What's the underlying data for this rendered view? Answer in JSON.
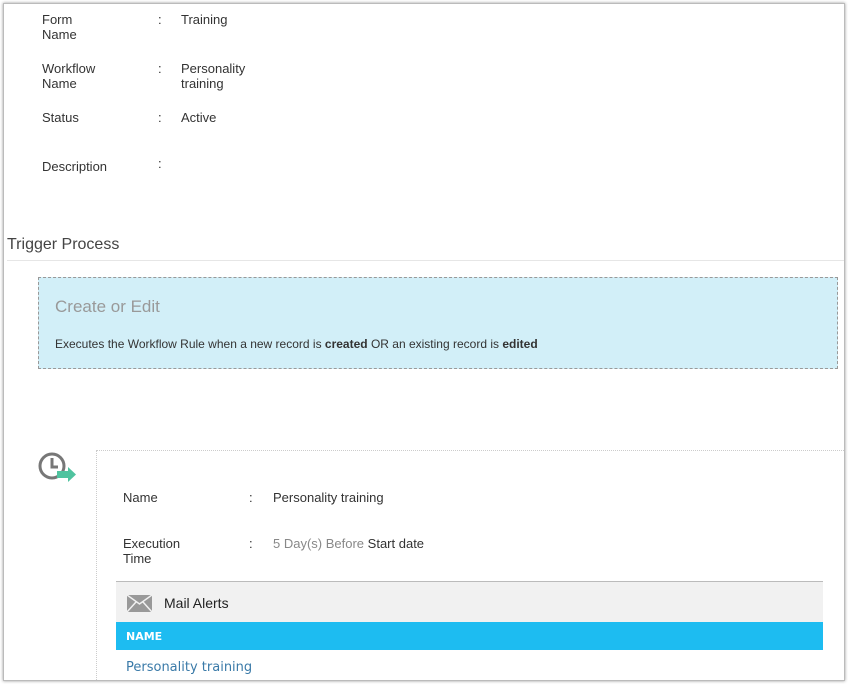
{
  "details": [
    {
      "label": "Form Name",
      "value": "Training"
    },
    {
      "label": "Workflow Name",
      "value": "Personality training"
    },
    {
      "label": "Status",
      "value": "Active"
    },
    {
      "label": "Description",
      "value": ""
    }
  ],
  "colon": ":",
  "trigger": {
    "section_title": "Trigger Process",
    "title": "Create or Edit",
    "desc_1": "Executes the Workflow Rule when a new record is ",
    "desc_bold_1": "created",
    "desc_2": " OR an existing record is ",
    "desc_bold_2": "edited"
  },
  "action": {
    "name_label": "Name",
    "name_value": "Personality training",
    "exec_label": "Execution Time",
    "exec_value_prefix": "5 Day(s) Before",
    "exec_value_field": "Start date",
    "mail_title": "Mail Alerts",
    "table_header": "NAME",
    "rows": [
      "Personality training"
    ]
  }
}
